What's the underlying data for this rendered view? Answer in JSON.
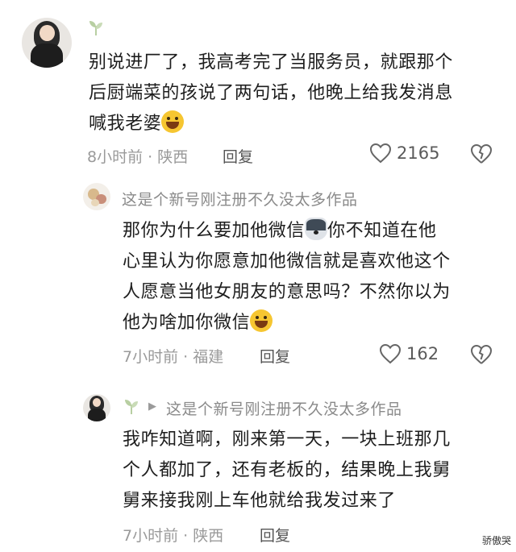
{
  "comments": [
    {
      "username": "",
      "lines": [
        "别说进厂了，我高考完了当服务员，就跟那个",
        "后厨端菜的孩说了两句话，他晚上给我发消息",
        "喊我老婆"
      ],
      "emoji_icon": "sweat-smile-emoji",
      "time": "8小时前",
      "location": "陕西",
      "reply_label": "回复",
      "likes": "2165"
    },
    {
      "username": "这是个新号刚注册不久没太多作品",
      "lines": [
        "那你为什么要加他微信",
        "你不知道在他",
        "心里认为你愿意加他微信就是喜欢他这个",
        "人愿意当他女朋友的意思吗？不然你以为",
        "他为啥加你微信"
      ],
      "emoji_icons": [
        "husky-emoji",
        "sweat-smile-emoji"
      ],
      "time": "7小时前",
      "location": "福建",
      "reply_label": "回复",
      "likes": "162"
    },
    {
      "username": "这是个新号刚注册不久没太多作品",
      "lines": [
        "我咋知道啊，刚来第一天，一块上班那几",
        "个人都加了，还有老板的，结果晚上我舅",
        "舅来接我刚上车他就给我发过来了"
      ],
      "time": "7小时前",
      "location": "陕西",
      "reply_label": "回复"
    }
  ],
  "meta_separator": "·",
  "watermark": "骄傲哭",
  "colors": {
    "text": "#1e1e1e",
    "meta": "#9a9a9a",
    "username": "#8a8a8a",
    "badge": "#b8cfa2"
  }
}
